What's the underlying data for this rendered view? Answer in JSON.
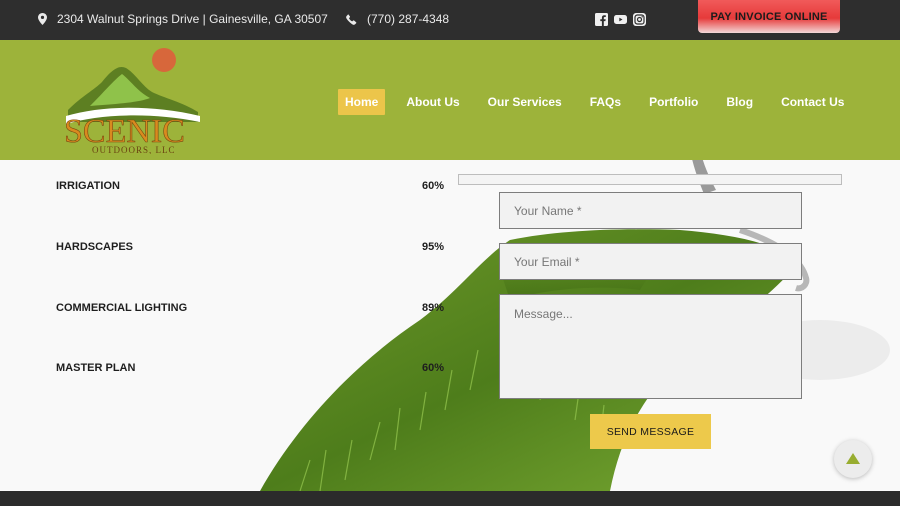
{
  "topbar": {
    "address": "2304 Walnut Springs Drive | Gainesville, GA 30507",
    "phone": "(770) 287-4348",
    "social_icons": [
      "facebook-icon",
      "youtube-icon",
      "instagram-icon"
    ],
    "pay_button": "PAY INVOICE ONLINE"
  },
  "logo": {
    "text_main": "SCENIC",
    "text_sub": "OUTDOORS, LLC"
  },
  "nav": {
    "items": [
      {
        "label": "Home",
        "active": true
      },
      {
        "label": "About Us"
      },
      {
        "label": "Our Services"
      },
      {
        "label": "FAQs"
      },
      {
        "label": "Portfolio"
      },
      {
        "label": "Blog"
      },
      {
        "label": "Contact Us"
      }
    ]
  },
  "skills": [
    {
      "name": "IRRIGATION",
      "percent": "60%",
      "value": 60
    },
    {
      "name": "HARDSCAPES",
      "percent": "95%",
      "value": 95
    },
    {
      "name": "COMMERCIAL LIGHTING",
      "percent": "89%",
      "value": 89
    },
    {
      "name": "MASTER PLAN",
      "percent": "60%",
      "value": 60
    }
  ],
  "form": {
    "name_placeholder": "Your Name *",
    "email_placeholder": "Your Email *",
    "message_placeholder": "Message...",
    "name_value": "",
    "email_value": "",
    "message_value": "",
    "submit_label": "SEND MESSAGE"
  },
  "colors": {
    "topbar": "#2e2e2e",
    "header_green": "#9db33a",
    "accent_yellow": "#edc94b",
    "pay_red": "#e63a3a"
  }
}
